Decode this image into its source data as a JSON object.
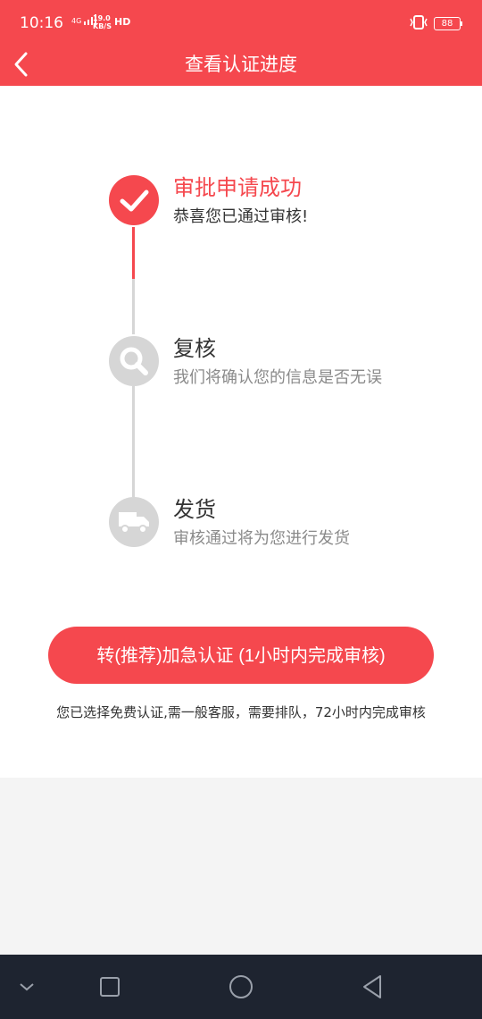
{
  "status": {
    "time": "10:16",
    "network": "4G",
    "speed_value": "19.0",
    "speed_unit": "KB/S",
    "hd": "HD",
    "battery": "88"
  },
  "header": {
    "title": "查看认证进度"
  },
  "steps": [
    {
      "title": "审批申请成功",
      "subtitle": "恭喜您已通过审核!",
      "status": "done",
      "icon": "check-icon"
    },
    {
      "title": "复核",
      "subtitle": "我们将确认您的信息是否无误",
      "status": "pending",
      "icon": "search-icon"
    },
    {
      "title": "发货",
      "subtitle": "审核通过将为您进行发货",
      "status": "pending",
      "icon": "truck-icon"
    }
  ],
  "cta": {
    "label": "转(推荐)加急认证 (1小时内完成审核)"
  },
  "note": "您已选择免费认证,需一般客服，需要排队，72小时内完成审核",
  "colors": {
    "accent": "#f5484e",
    "inactive": "#d6d6d6",
    "nav_bg": "#1e2430"
  }
}
